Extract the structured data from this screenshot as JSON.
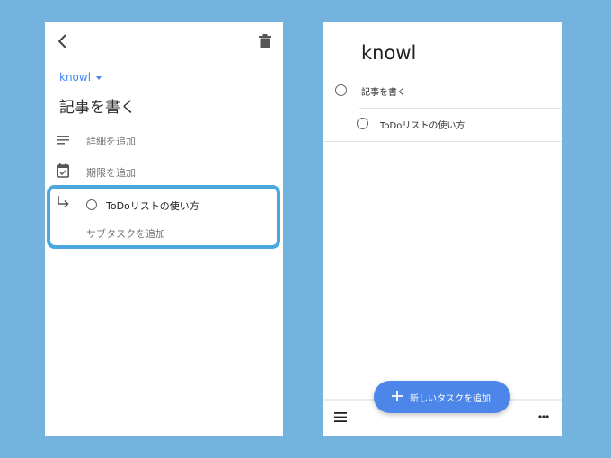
{
  "colors": {
    "background": "#74b3de",
    "accent": "#4285f4",
    "highlight": "#4aa8de",
    "fab": "#4b86e8"
  },
  "detail_view": {
    "back_icon": "chevron-left-icon",
    "delete_icon": "trash-icon",
    "list_selector": "knowl",
    "task_title": "記事を書く",
    "details_placeholder": "詳細を追加",
    "date_placeholder": "期限を追加",
    "subtasks": [
      {
        "title": "ToDoリストの使い方",
        "completed": false
      }
    ],
    "add_subtask_placeholder": "サブタスクを追加"
  },
  "list_view": {
    "title": "knowl",
    "tasks": [
      {
        "title": "記事を書く",
        "completed": false,
        "level": 0
      },
      {
        "title": "ToDoリストの使い方",
        "completed": false,
        "level": 1
      }
    ],
    "fab_label": "新しいタスクを追加",
    "menu_icon": "hamburger-menu-icon",
    "more_icon": "more-horizontal-icon"
  }
}
